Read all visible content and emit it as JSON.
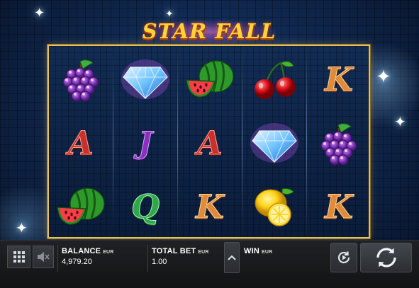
{
  "game": {
    "logo_text": "STAR FALL"
  },
  "reels": {
    "columns": [
      [
        "grapes",
        "A",
        "watermelon"
      ],
      [
        "diamond",
        "J",
        "Q"
      ],
      [
        "watermelon",
        "A",
        "K"
      ],
      [
        "cherries",
        "diamond",
        "lemon"
      ],
      [
        "K",
        "grapes",
        "K"
      ]
    ]
  },
  "hud": {
    "menu_icon": "grid-icon",
    "sound_icon": "speaker-muted-icon",
    "balance_label": "BALANCE",
    "balance_currency": "EUR",
    "balance_value": "4,979.20",
    "total_bet_label": "TOTAL BET",
    "total_bet_currency": "EUR",
    "total_bet_value": "1.00",
    "bet_arrow_icon": "chevron-up-icon",
    "win_label": "WIN",
    "win_currency": "EUR",
    "autoplay_icon": "autoplay-icon",
    "spin_icon": "spin-icon"
  },
  "colors": {
    "frame_gold": "#e8c15a",
    "logo_yellow": "#ffd23a",
    "background_blue": "#10284f"
  }
}
